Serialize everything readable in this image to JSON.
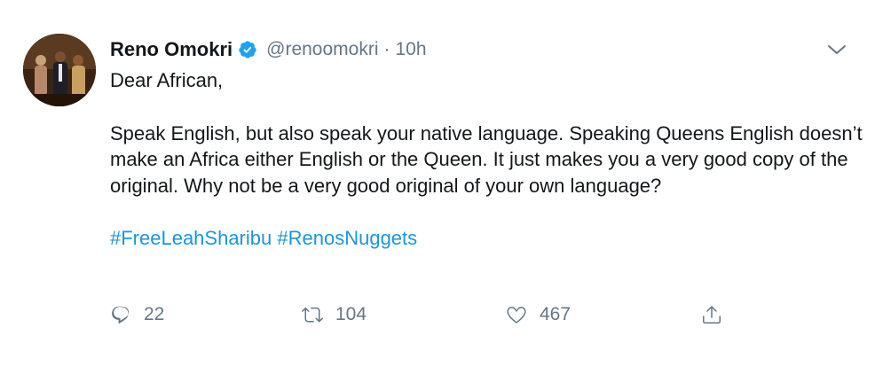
{
  "author": {
    "name": "Reno Omokri",
    "handle": "@renoomokri",
    "separator": "·",
    "time": "10h",
    "verified": true
  },
  "tweet": {
    "greeting": "Dear African,",
    "paragraph": "Speak English, but also speak your native language. Speaking Queens English doesn’t make an Africa either English or the Queen. It just makes you a very good copy of the original. Why not be a very good original of your own language?",
    "hashtags": [
      "#FreeLeahSharibu",
      "#RenosNuggets"
    ]
  },
  "actions": {
    "replies": "22",
    "retweets": "104",
    "likes": "467"
  },
  "colors": {
    "text": "#14171a",
    "secondary": "#657786",
    "link": "#1b95e0",
    "verified_badge": "#1da1f2"
  },
  "icons": [
    "verified-badge-icon",
    "chevron-down-icon",
    "reply-icon",
    "retweet-icon",
    "like-icon",
    "share-icon"
  ]
}
